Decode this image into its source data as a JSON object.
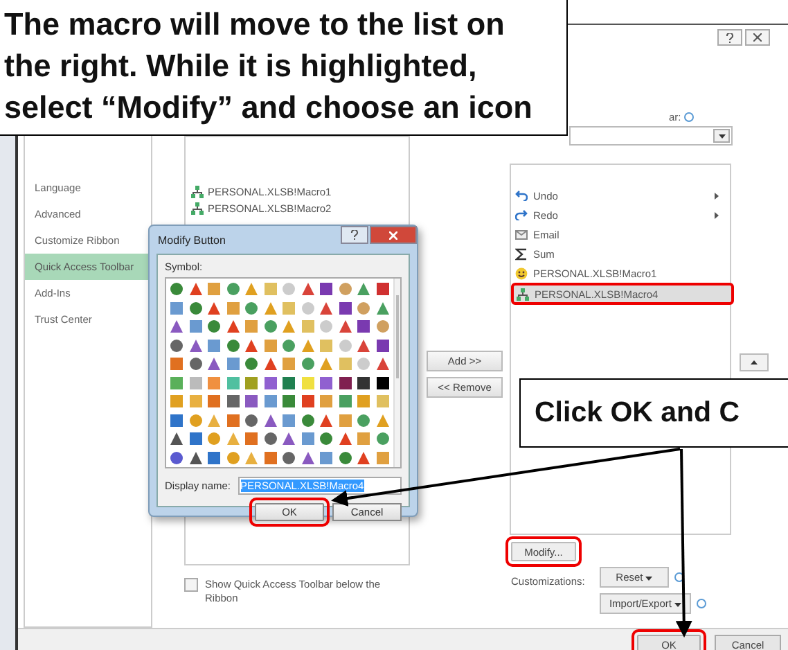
{
  "callouts": [
    {
      "text": "The macro will move to the list on the right. While it is highlighted, select “Modify” and choose an icon"
    },
    {
      "text": "Click OK and C"
    }
  ],
  "options_window": {
    "sidebar": [
      {
        "label": "Language",
        "selected": false
      },
      {
        "label": "Advanced",
        "selected": false
      },
      {
        "label": "Customize Ribbon",
        "selected": false
      },
      {
        "label": "Quick Access Toolbar",
        "selected": true
      },
      {
        "label": "Add-Ins",
        "selected": false
      },
      {
        "label": "Trust Center",
        "selected": false
      }
    ],
    "commands": [
      "PERSONAL.XLSB!Macro1",
      "PERSONAL.XLSB!Macro2"
    ],
    "customize_label": "ar:",
    "add_button": "Add >>",
    "remove_button": "<< Remove",
    "toolbar_items": [
      {
        "label": "Undo",
        "kind": "undo",
        "submenu": true,
        "selected": false,
        "highlighted": false
      },
      {
        "label": "Redo",
        "kind": "redo",
        "submenu": true,
        "selected": false,
        "highlighted": false
      },
      {
        "label": "Email",
        "kind": "email",
        "submenu": false,
        "selected": false,
        "highlighted": false
      },
      {
        "label": "Sum",
        "kind": "sum",
        "submenu": false,
        "selected": false,
        "highlighted": false
      },
      {
        "label": "PERSONAL.XLSB!Macro1",
        "kind": "smiley",
        "submenu": false,
        "selected": false,
        "highlighted": false
      },
      {
        "label": "PERSONAL.XLSB!Macro4",
        "kind": "macro",
        "submenu": false,
        "selected": true,
        "highlighted": true
      }
    ],
    "show_below": {
      "label": "Show Quick Access Toolbar below the Ribbon",
      "checked": false
    },
    "modify_button": {
      "label": "Modify...",
      "highlighted": true
    },
    "customizations_label": "Customizations:",
    "reset_button": "Reset",
    "import_export_button": "Import/Export",
    "ok_button": {
      "label": "OK",
      "highlighted": true
    },
    "cancel_button": "Cancel"
  },
  "dialog": {
    "title": "Modify Button",
    "symbol_label": "Symbol:",
    "display_name_label": "Display name:",
    "display_name": "PERSONAL.XLSB!Macro4",
    "ok_button": {
      "label": "OK",
      "highlighted": true
    },
    "cancel_button": "Cancel"
  }
}
